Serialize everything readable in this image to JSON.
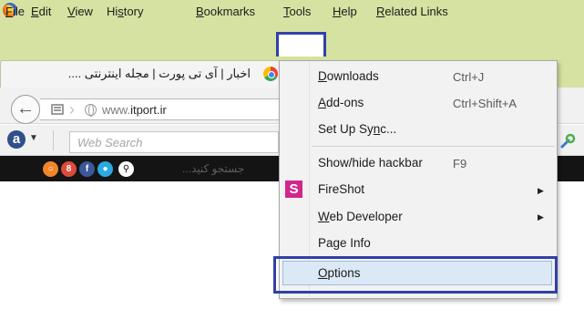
{
  "menubar": {
    "items": [
      {
        "pre": "",
        "ul": "F",
        "post": "ile"
      },
      {
        "pre": "",
        "ul": "E",
        "post": "dit"
      },
      {
        "pre": "",
        "ul": "V",
        "post": "iew"
      },
      {
        "pre": "Hi",
        "ul": "s",
        "post": "tory"
      },
      {
        "pre": "",
        "ul": "B",
        "post": "ookmarks"
      },
      {
        "pre": "",
        "ul": "T",
        "post": "ools"
      },
      {
        "pre": "",
        "ul": "H",
        "post": "elp"
      },
      {
        "pre": "",
        "ul": "R",
        "post": "elated Links"
      }
    ]
  },
  "tab": {
    "title": "اخبار | آی تی پورت | مجله اینترنتی ...."
  },
  "navbar": {
    "url_plain": "www.",
    "url_domain": "itport.ir"
  },
  "search": {
    "placeholder": "Web Search",
    "logo_letter": "a"
  },
  "site": {
    "search_hint": "جستجو کنید...",
    "social": [
      "rss",
      "g+",
      "f",
      "twitter",
      "search"
    ]
  },
  "tools_menu": {
    "items": [
      {
        "pre": "",
        "ul": "D",
        "post": "ownloads",
        "shortcut": "Ctrl+J"
      },
      {
        "pre": "",
        "ul": "A",
        "post": "dd-ons",
        "shortcut": "Ctrl+Shift+A"
      },
      {
        "pre": "Set Up Sy",
        "ul": "n",
        "post": "c..."
      },
      {
        "pre": "Show/hide hackbar",
        "ul": "",
        "post": "",
        "shortcut": "F9"
      },
      {
        "pre": "FireShot",
        "ul": "",
        "post": "",
        "icon_letter": "S"
      },
      {
        "pre": "",
        "ul": "W",
        "post": "eb Developer"
      },
      {
        "pre": "Pa",
        "ul": "g",
        "post": "e Info"
      },
      {
        "pre": "",
        "ul": "O",
        "post": "ptions"
      }
    ]
  },
  "colors": {
    "frame": "#d5e2a1",
    "highlight_border": "#3140a8",
    "selection": "#dbe8f5",
    "fireshot": "#d2268d"
  }
}
